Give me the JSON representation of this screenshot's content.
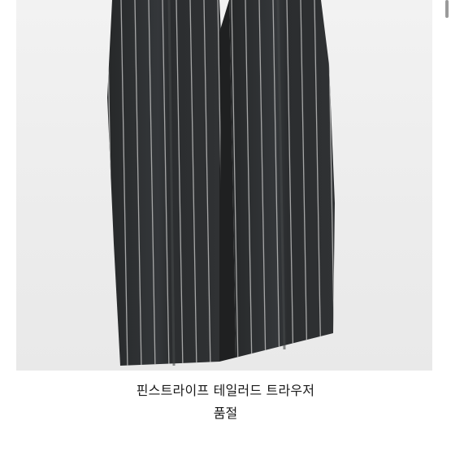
{
  "product": {
    "image_alt": "pinstripe tailored trousers photo",
    "title": "핀스트라이프 테일러드 트라우저",
    "status": "품절"
  },
  "colors": {
    "photo_bg": "#efefef",
    "fabric": "#2f3133",
    "stripe": "#bfbfbf"
  }
}
